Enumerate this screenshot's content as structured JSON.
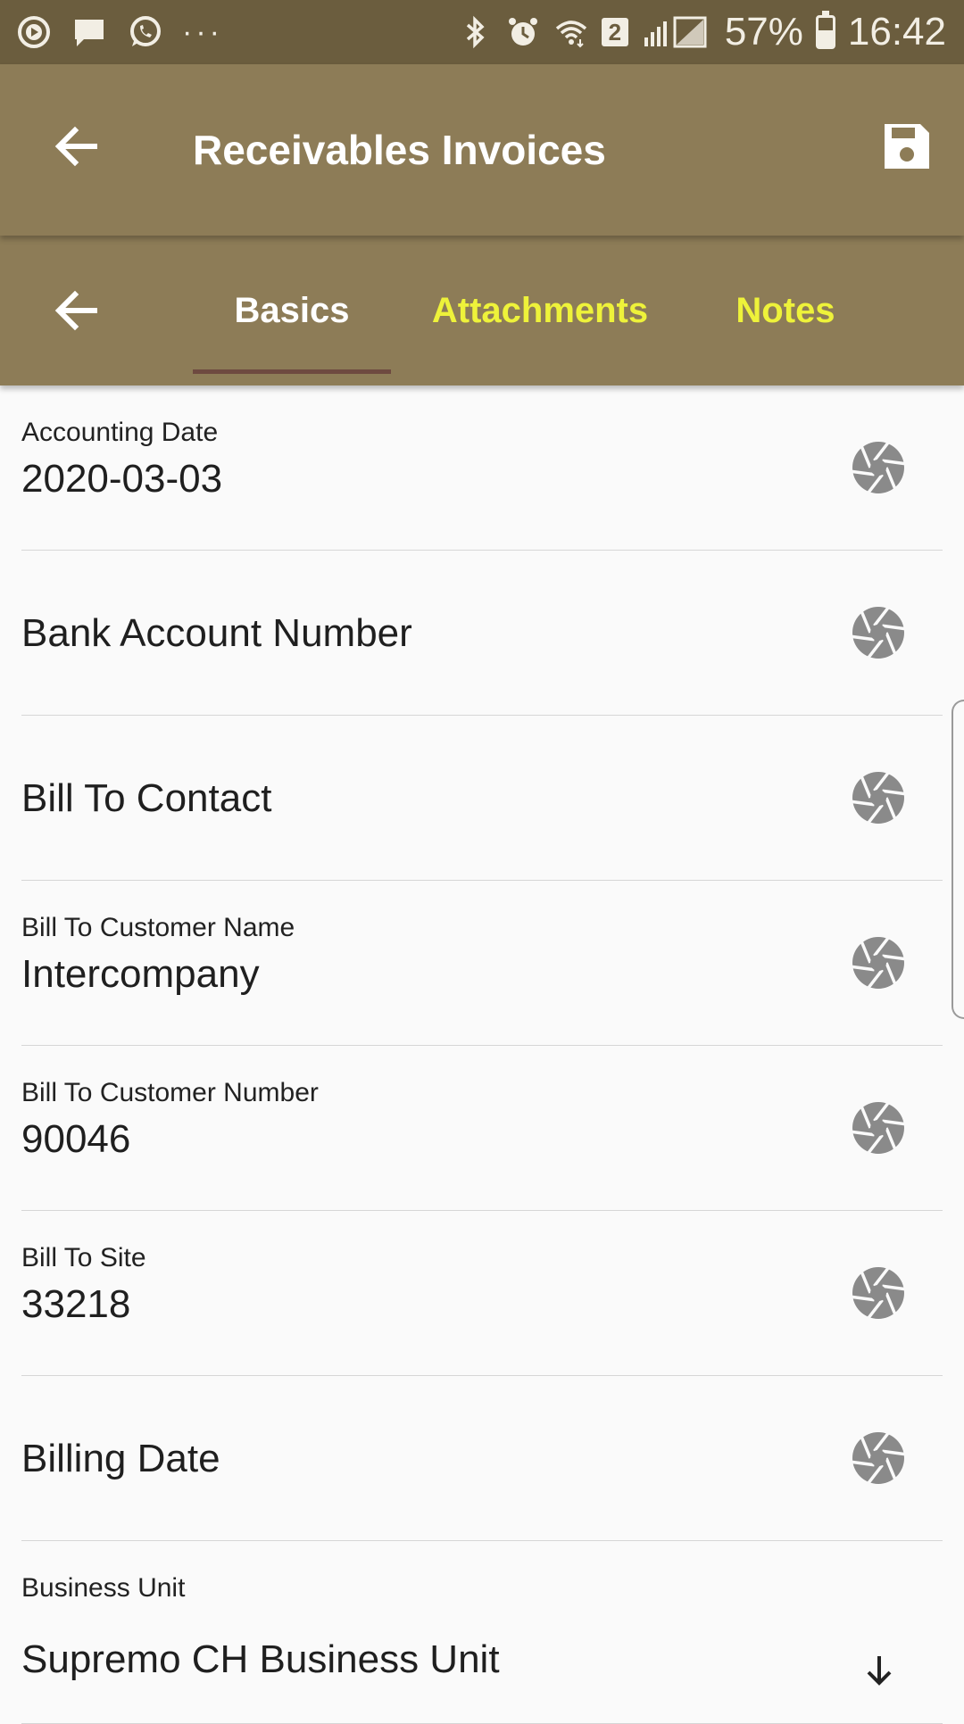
{
  "status_bar": {
    "left_icons": [
      "play-circle-icon",
      "chat-bubble-icon",
      "whatsapp-icon"
    ],
    "more": "···",
    "right_icons": [
      "bluetooth-icon",
      "alarm-icon",
      "wifi-icon",
      "signal-icon"
    ],
    "sim": "2",
    "battery": "57%",
    "battery_level": 0.57,
    "time": "16:42"
  },
  "app_bar": {
    "title": "Receivables Invoices",
    "back_icon": "arrow-back-icon",
    "save_icon": "save-icon"
  },
  "tabs": [
    {
      "label": "Basics",
      "active": true
    },
    {
      "label": "Attachments",
      "active": false
    },
    {
      "label": "Notes",
      "active": false
    }
  ],
  "fields": [
    {
      "label": "Accounting Date",
      "value": "2020-03-03",
      "action": "camera"
    },
    {
      "label": "",
      "value": "Bank Account Number",
      "action": "camera"
    },
    {
      "label": "",
      "value": "Bill To Contact",
      "action": "camera"
    },
    {
      "label": "Bill To Customer Name",
      "value": "Intercompany",
      "action": "camera"
    },
    {
      "label": "Bill To Customer Number",
      "value": "90046",
      "action": "camera"
    },
    {
      "label": "Bill To Site",
      "value": "33218",
      "action": "camera"
    },
    {
      "label": "",
      "value": "Billing Date",
      "action": "camera"
    },
    {
      "label": "Business Unit",
      "value": "Supremo CH Business Unit",
      "action": "dropdown"
    }
  ],
  "colors": {
    "status_bar": "#6b5d3e",
    "app_bar": "#8d7c57",
    "tab_active": "#ffffff",
    "tab_inactive": "#eef23a",
    "tab_indicator": "#6e4a40",
    "icon_gray": "#8a8a8a"
  }
}
